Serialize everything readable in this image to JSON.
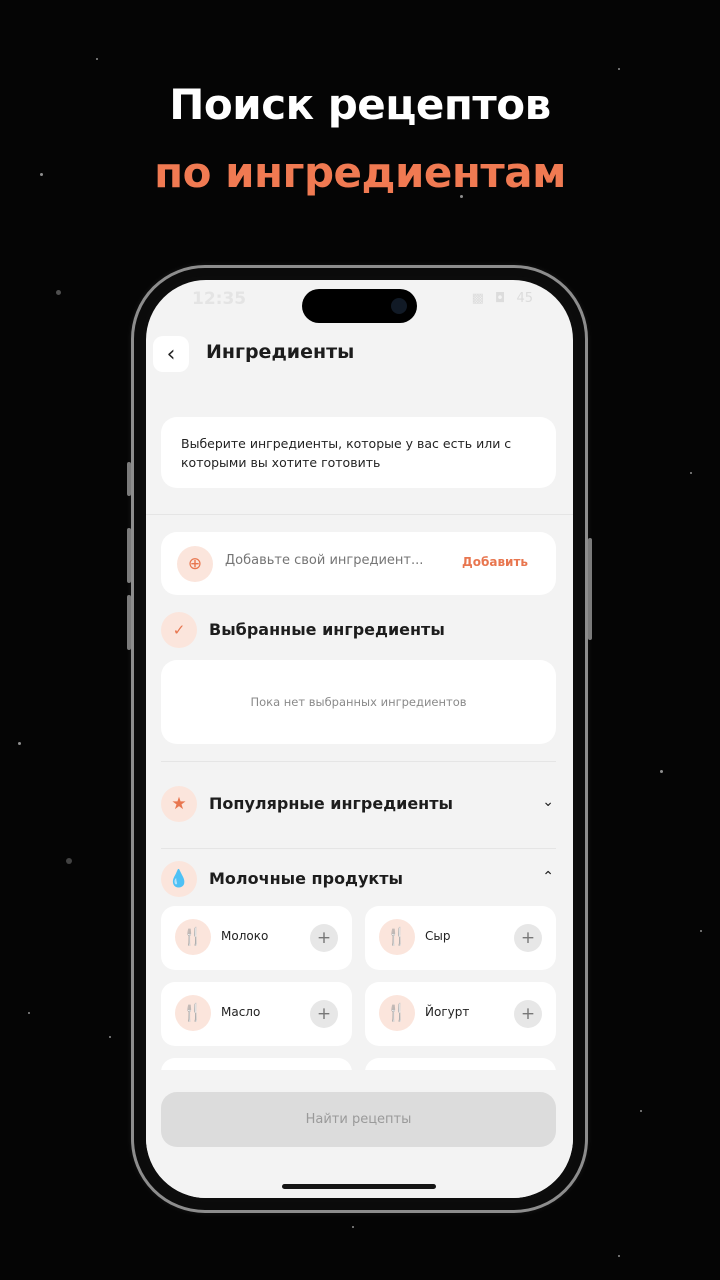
{
  "headline": {
    "line1": "Поиск рецептов",
    "line2": "по ингредиентам",
    "accent_color": "#f07a52"
  },
  "status_bar": {
    "time": "12:35",
    "battery": "45"
  },
  "header": {
    "title": "Ингредиенты"
  },
  "info_text": "Выберите ингредиенты, которые у вас есть или с которыми вы хотите готовить",
  "add_ingredient": {
    "placeholder": "Добавьте свой ингредиент...",
    "button_label": "Добавить"
  },
  "selected": {
    "title": "Выбранные ингредиенты",
    "empty_text": "Пока нет выбранных ингредиентов"
  },
  "popular": {
    "title": "Популярные ингредиенты",
    "expanded": false
  },
  "dairy": {
    "title": "Молочные продукты",
    "expanded": true,
    "items": [
      {
        "label": "Молоко"
      },
      {
        "label": "Сыр"
      },
      {
        "label": "Масло"
      },
      {
        "label": "Йогурт"
      }
    ]
  },
  "find_button": {
    "label": "Найти рецепты",
    "enabled": false
  },
  "icons": {
    "back": "chevron-left-icon",
    "add": "plus-circle-icon",
    "selected": "check-circle-icon",
    "popular": "star-icon",
    "dairy": "drop-icon",
    "ingredient": "fork-knife-icon"
  }
}
